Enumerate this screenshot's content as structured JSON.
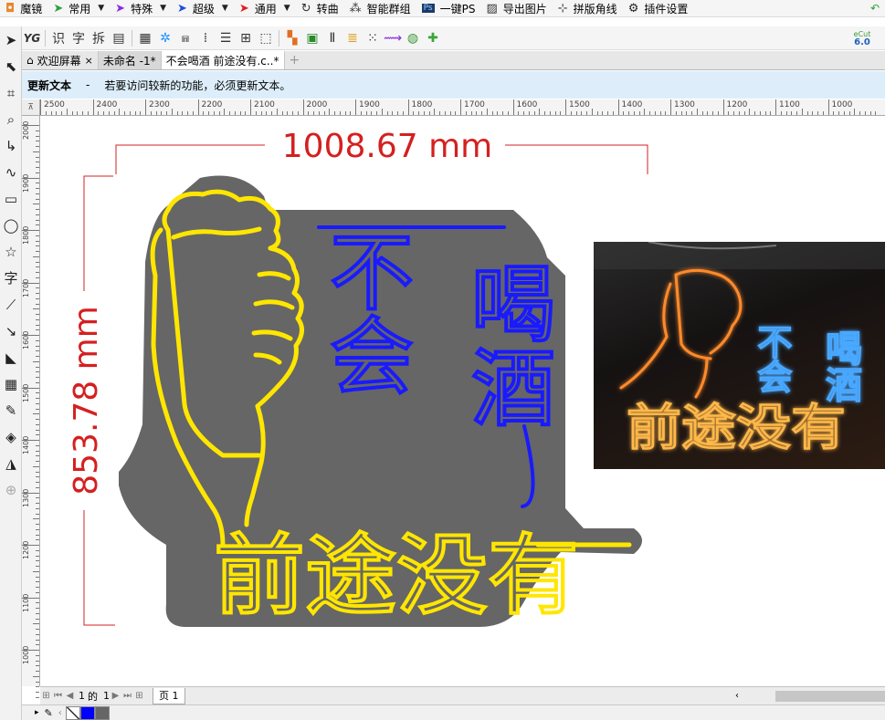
{
  "menubar": {
    "items": [
      {
        "icon": "mirror-icon",
        "label": "魔镜",
        "color": "#e8882c",
        "caret": false
      },
      {
        "icon": "arrow-icon",
        "label": "常用",
        "color": "#2e9e3e",
        "caret": true
      },
      {
        "icon": "arrow-icon",
        "label": "特殊",
        "color": "#8a2be2",
        "caret": true
      },
      {
        "icon": "arrow-icon",
        "label": "超级",
        "color": "#1f4ed8",
        "caret": true
      },
      {
        "icon": "arrow-icon",
        "label": "通用",
        "color": "#e02020",
        "caret": true
      },
      {
        "icon": "curve-icon",
        "label": "转曲",
        "color": "#333333",
        "caret": false
      },
      {
        "icon": "group-icon",
        "label": "智能群组",
        "color": "#333333",
        "caret": false
      },
      {
        "icon": "ps-icon",
        "label": "一键PS",
        "color": "#1b3a6b",
        "caret": false
      },
      {
        "icon": "image-icon",
        "label": "导出图片",
        "color": "#333333",
        "caret": false
      },
      {
        "icon": "crop-marks-icon",
        "label": "拼版角线",
        "color": "#333333",
        "caret": false
      },
      {
        "icon": "gear-icon",
        "label": "插件设置",
        "color": "#222222",
        "caret": false
      }
    ],
    "undo_icon": "undo-icon"
  },
  "toolbar": {
    "text_buttons": [
      "YG",
      "识",
      "字",
      "拆"
    ],
    "badge": {
      "top": "eCut",
      "bottom": "6.0"
    }
  },
  "tabs": [
    {
      "label": "欢迎屏幕",
      "closable": true,
      "active": false
    },
    {
      "label": "未命名 -1*",
      "closable": false,
      "active": false
    },
    {
      "label": "不会喝酒 前途没有.c..*",
      "closable": false,
      "active": true
    }
  ],
  "notice": {
    "title": "更新文本",
    "dash": "-",
    "message": "若要访问较新的功能，必须更新文本。"
  },
  "ruler": {
    "h_labels": [
      "2500",
      "2400",
      "2300",
      "2200",
      "2100",
      "2000",
      "1900",
      "1800",
      "1700",
      "1600",
      "1500",
      "1400",
      "1300",
      "1200",
      "1100",
      "1000"
    ],
    "v_labels": [
      "2000",
      "1900",
      "1800",
      "1700",
      "1600",
      "1500",
      "1400",
      "1300",
      "1200",
      "1100",
      "1000"
    ],
    "corner": "⊼"
  },
  "design": {
    "width_dim": "1008.67 mm",
    "height_dim": "853.78 mm",
    "line1": "不会",
    "line2": "喝酒",
    "line3": "前途没有",
    "yellow": "#ffe600",
    "blue": "#1a1aff",
    "backing": "#666666",
    "dim_color": "#d42020"
  },
  "photo": {
    "line1": "不会",
    "line2": "喝酒",
    "line3": "前途没有"
  },
  "pagebar": {
    "current": "1",
    "of": "的",
    "total": "1",
    "page_tab": "页 1"
  },
  "palette": {
    "swatches": [
      "#0000ff",
      "#666666"
    ]
  }
}
